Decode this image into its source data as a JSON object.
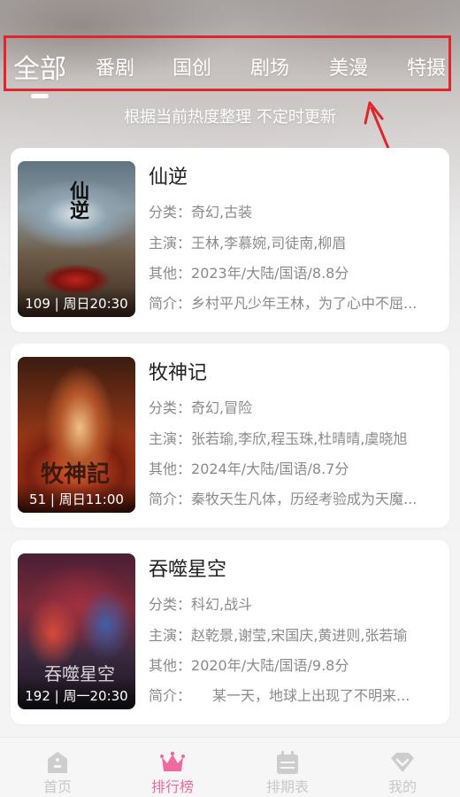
{
  "tabs": [
    {
      "label": "全部",
      "active": true
    },
    {
      "label": "番剧",
      "active": false
    },
    {
      "label": "国创",
      "active": false
    },
    {
      "label": "剧场",
      "active": false
    },
    {
      "label": "美漫",
      "active": false
    },
    {
      "label": "特摄",
      "active": false
    }
  ],
  "subtitle": "根据当前热度整理 不定时更新",
  "items": [
    {
      "title": "仙逆",
      "caption": "109 | 周日20:30",
      "poster_text": "仙逆",
      "category_label": "分类：",
      "category": "奇幻,古装",
      "cast_label": "主演：",
      "cast": "王林,李慕婉,司徒南,柳眉",
      "other_label": "其他：",
      "other": "2023年/大陆/国语/8.8分",
      "intro_label": "简介：",
      "intro": "乡村平凡少年王林，为了心中不屈..."
    },
    {
      "title": "牧神记",
      "caption": "51 | 周日11:00",
      "poster_text": "牧神記",
      "category_label": "分类：",
      "category": "奇幻,冒险",
      "cast_label": "主演：",
      "cast": "张若瑜,李欣,程玉珠,杜晴晴,虞晓旭",
      "other_label": "其他：",
      "other": "2024年/大陆/国语/8.7分",
      "intro_label": "简介：",
      "intro": "秦牧天生凡体，历经考验成为天魔..."
    },
    {
      "title": "吞噬星空",
      "caption": "192 | 周一20:30",
      "poster_text": "吞噬星空",
      "category_label": "分类：",
      "category": "科幻,战斗",
      "cast_label": "主演：",
      "cast": "赵乾景,谢莹,宋国庆,黄进则,张若瑜",
      "other_label": "其他：",
      "other": "2020年/大陆/国语/9.8分",
      "intro_label": "简介：",
      "intro": "　　某一天，地球上出现了不明来..."
    }
  ],
  "bottom_nav": [
    {
      "label": "首页",
      "icon": "home-icon",
      "active": false
    },
    {
      "label": "排行榜",
      "icon": "crown-icon",
      "active": true
    },
    {
      "label": "排期表",
      "icon": "calendar-icon",
      "active": false
    },
    {
      "label": "我的",
      "icon": "diamond-icon",
      "active": false
    }
  ],
  "colors": {
    "highlight_box": "#e0252c",
    "active_nav": "#f06a9e",
    "inactive_nav": "#c8c8c8"
  }
}
